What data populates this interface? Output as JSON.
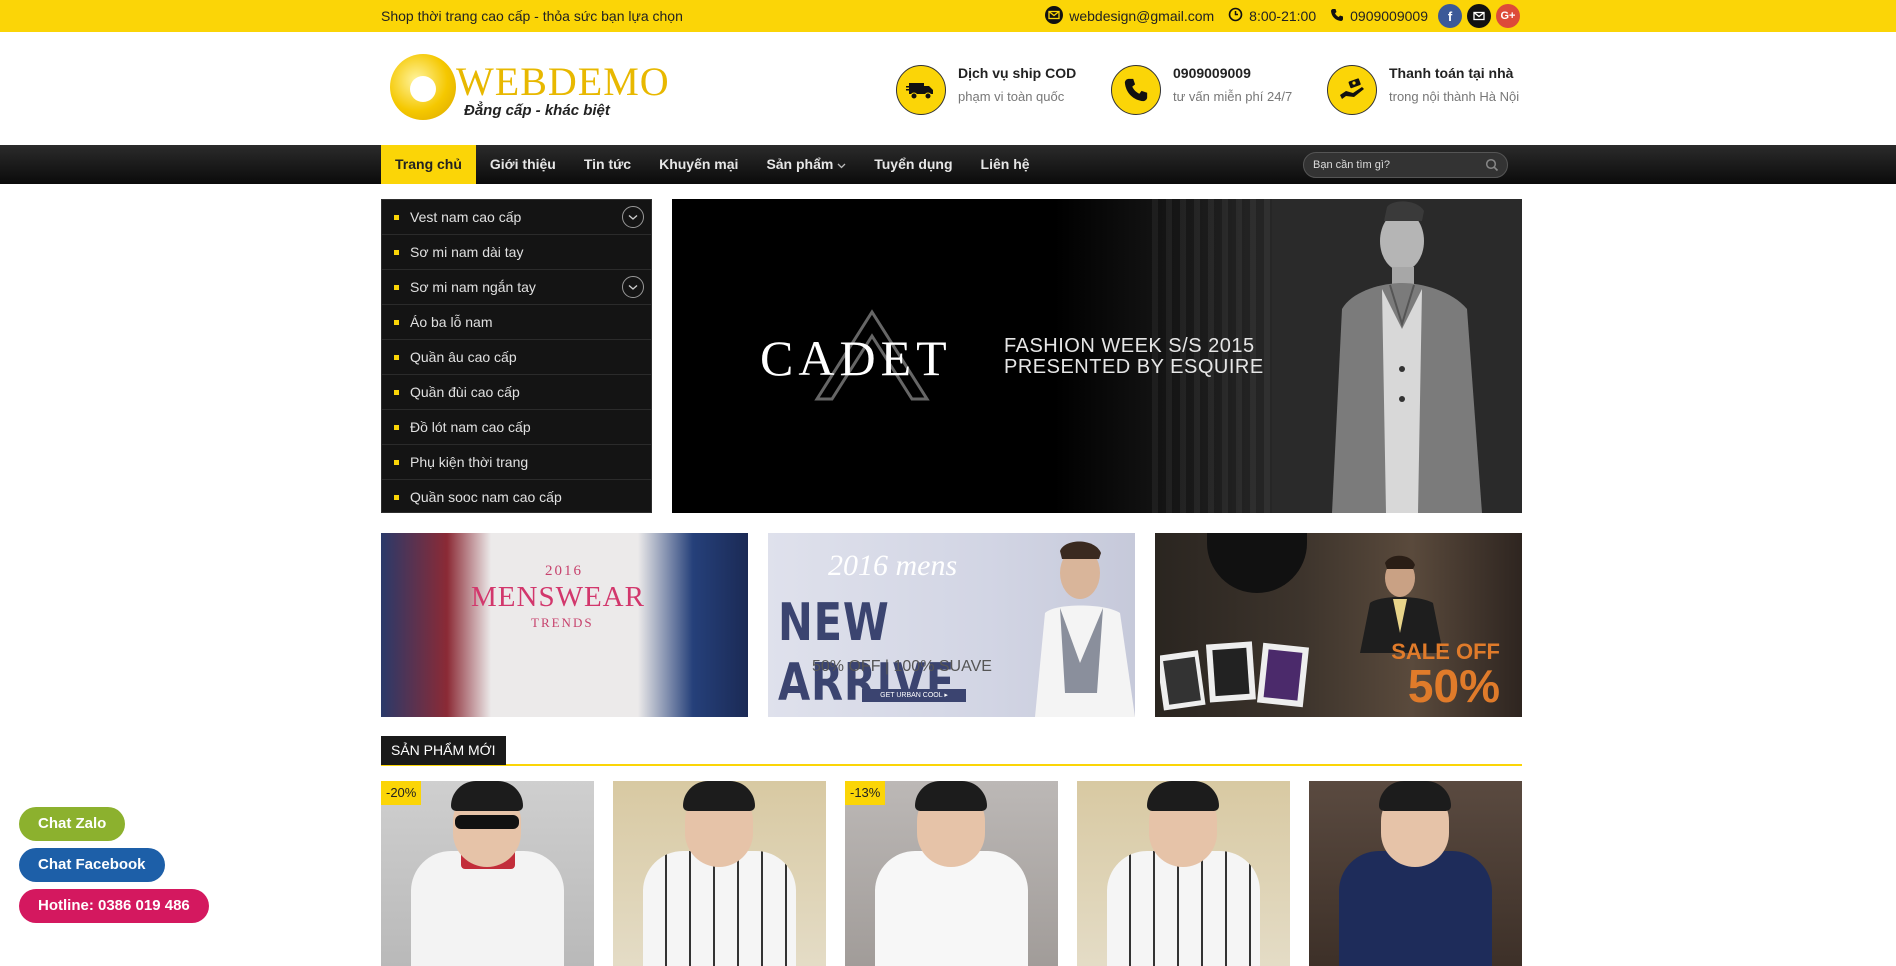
{
  "topbar": {
    "tagline": "Shop thời trang cao cấp - thỏa sức bạn lựa chọn",
    "email": "webdesign@gmail.com",
    "hours": "8:00-21:00",
    "phone": "0909009009",
    "social": {
      "facebook": "f",
      "google": "G+"
    }
  },
  "header": {
    "logo": {
      "brand": "WEBDEMO",
      "slogan": "Đẳng cấp - khác biệt"
    },
    "services": [
      {
        "icon": "truck-icon",
        "title": "Dịch vụ ship COD",
        "subtitle": "phạm vi toàn quốc"
      },
      {
        "icon": "phone-icon",
        "title": "0909009009",
        "subtitle": "tư vấn miễn phí 24/7"
      },
      {
        "icon": "payment-icon",
        "title": "Thanh toán tại nhà",
        "subtitle": "trong nội thành Hà Nội"
      }
    ]
  },
  "nav": {
    "items": [
      {
        "label": "Trang chủ",
        "active": true
      },
      {
        "label": "Giới thiệu"
      },
      {
        "label": "Tin tức"
      },
      {
        "label": "Khuyến mại"
      },
      {
        "label": "Sản phẩm",
        "dropdown": true
      },
      {
        "label": "Tuyển dụng"
      },
      {
        "label": "Liên hệ"
      }
    ],
    "search_placeholder": "Bạn cần tìm gì?"
  },
  "categories": [
    {
      "label": "Vest nam cao cấp",
      "expandable": true
    },
    {
      "label": "Sơ mi nam dài tay"
    },
    {
      "label": "Sơ mi nam ngắn tay",
      "expandable": true
    },
    {
      "label": "Áo ba lỗ nam"
    },
    {
      "label": "Quần âu cao cấp"
    },
    {
      "label": "Quần đùi cao cấp"
    },
    {
      "label": "Đồ lót nam cao cấp"
    },
    {
      "label": "Phụ kiện thời trang"
    },
    {
      "label": "Quần sooc nam cao cấp"
    }
  ],
  "hero": {
    "brand": "CADET",
    "line1": "FASHION WEEK S/S 2015",
    "line2": "PRESENTED BY ESQUIRE"
  },
  "banners": [
    {
      "year": "2016",
      "main": "MENSWEAR",
      "sub": "TRENDS"
    },
    {
      "year": "2016 mens",
      "main": "NEW ARRIVE",
      "sub": "50% OFF | 100% SUAVE",
      "button": "GET URBAN COOL ▸"
    },
    {
      "line1": "SALE OFF",
      "line2": "50%"
    }
  ],
  "section": {
    "title": "SẢN PHẨM MỚI"
  },
  "products": [
    {
      "badge": "-20%"
    },
    {
      "badge": ""
    },
    {
      "badge": "-13%"
    },
    {
      "badge": ""
    },
    {
      "badge": ""
    }
  ],
  "chat": {
    "zalo": "Chat Zalo",
    "facebook": "Chat Facebook",
    "hotline": "Hotline: 0386 019 486"
  },
  "colors": {
    "accent": "#fbd507",
    "nav_dark": "#141414",
    "zalo": "#8cb12e",
    "facebook": "#1d5fa8",
    "hotline": "#d4185f"
  }
}
